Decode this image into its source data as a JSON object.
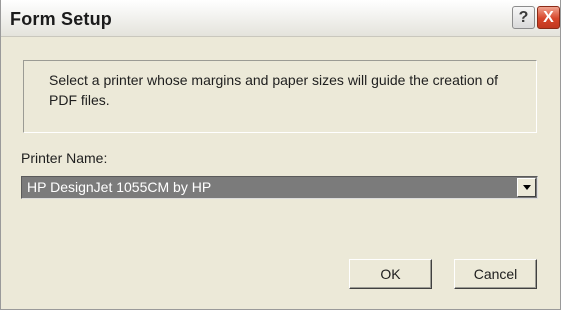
{
  "window": {
    "title": "Form Setup",
    "help_icon": "?",
    "close_icon": "X"
  },
  "info": {
    "line1": "Select a printer whose margins and paper sizes will guide the creation of",
    "line2": "PDF files."
  },
  "printer": {
    "label": "Printer Name:",
    "selected": "HP DesignJet 1055CM by HP"
  },
  "buttons": {
    "ok": "OK",
    "cancel": "Cancel"
  }
}
